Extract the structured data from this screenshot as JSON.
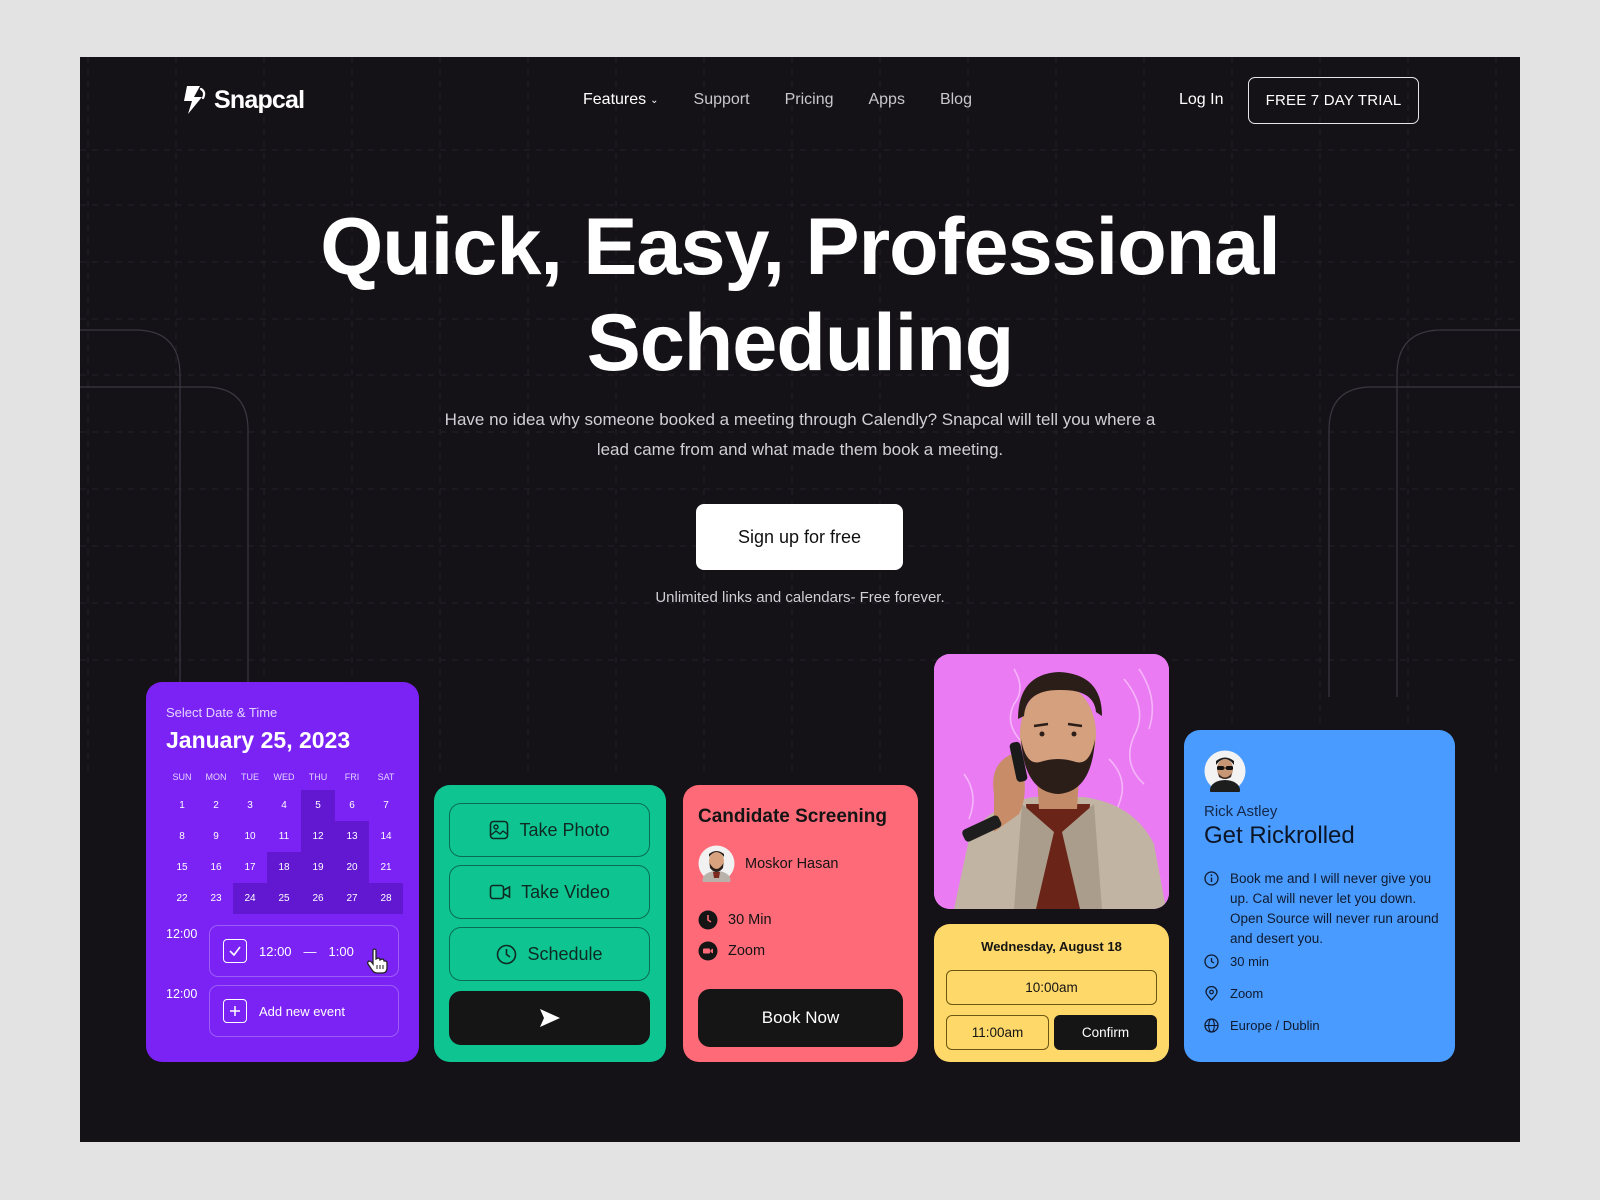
{
  "colors": {
    "page_bg": "#141217",
    "calendar_card": "#7b22f5",
    "green_card": "#0ec592",
    "pink_card": "#fe6a78",
    "photo_card": "#ea7bf3",
    "yellow_card": "#fed868",
    "blue_card": "#4a9bff"
  },
  "brand": {
    "name": "Snapcal",
    "icon": "snapcal-logo-icon"
  },
  "nav": {
    "items": [
      {
        "label": "Features",
        "active": true,
        "has_dropdown": true
      },
      {
        "label": "Support"
      },
      {
        "label": "Pricing"
      },
      {
        "label": "Apps"
      },
      {
        "label": "Blog"
      }
    ],
    "login": "Log In",
    "trial": "FREE 7 DAY TRIAL"
  },
  "hero": {
    "title_line1": "Quick, Easy, Professional",
    "title_line2": "Scheduling",
    "subtitle_line1": "Have no idea why someone booked a meeting through Calendly? Snapcal will tell you where a",
    "subtitle_line2": "lead came from and what made them book a meeting.",
    "cta": "Sign up for free",
    "note": "Unlimited links and calendars- Free forever."
  },
  "calendar": {
    "subtitle": "Select Date & Time",
    "date": "January 25, 2023",
    "weekdays": [
      "SUN",
      "MON",
      "TUE",
      "WED",
      "THU",
      "FRI",
      "SAT"
    ],
    "weeks": [
      [
        "1",
        "2",
        "3",
        "4",
        "5",
        "6",
        "7"
      ],
      [
        "8",
        "9",
        "10",
        "11",
        "12",
        "13",
        "14"
      ],
      [
        "15",
        "16",
        "17",
        "18",
        "19",
        "20",
        "21"
      ],
      [
        "22",
        "23",
        "24",
        "25",
        "26",
        "27",
        "28"
      ]
    ],
    "highlighted": [
      "5",
      "12",
      "13",
      "18",
      "19",
      "20",
      "24",
      "25",
      "26",
      "27",
      "28"
    ],
    "slot1_label": "12:00",
    "slot1_start": "12:00",
    "slot1_dash": "—",
    "slot1_end": "1:00",
    "slot2_label": "12:00",
    "slot2_text": "Add new event"
  },
  "actions": {
    "take_photo": "Take Photo",
    "take_video": "Take Video",
    "schedule": "Schedule"
  },
  "screening": {
    "title": "Candidate Screening",
    "person": "Moskor Hasan",
    "duration": "30 Min",
    "platform": "Zoom",
    "cta": "Book Now"
  },
  "booking": {
    "date": "Wednesday, August 18",
    "slot_a": "10:00am",
    "slot_b": "11:00am",
    "confirm": "Confirm"
  },
  "event": {
    "host": "Rick Astley",
    "title": "Get Rickrolled",
    "description": "Book me and I will never give you up. Cal will never let you down. Open Source will never run around and desert you.",
    "duration": "30 min",
    "location": "Zoom",
    "timezone": "Europe / Dublin"
  }
}
